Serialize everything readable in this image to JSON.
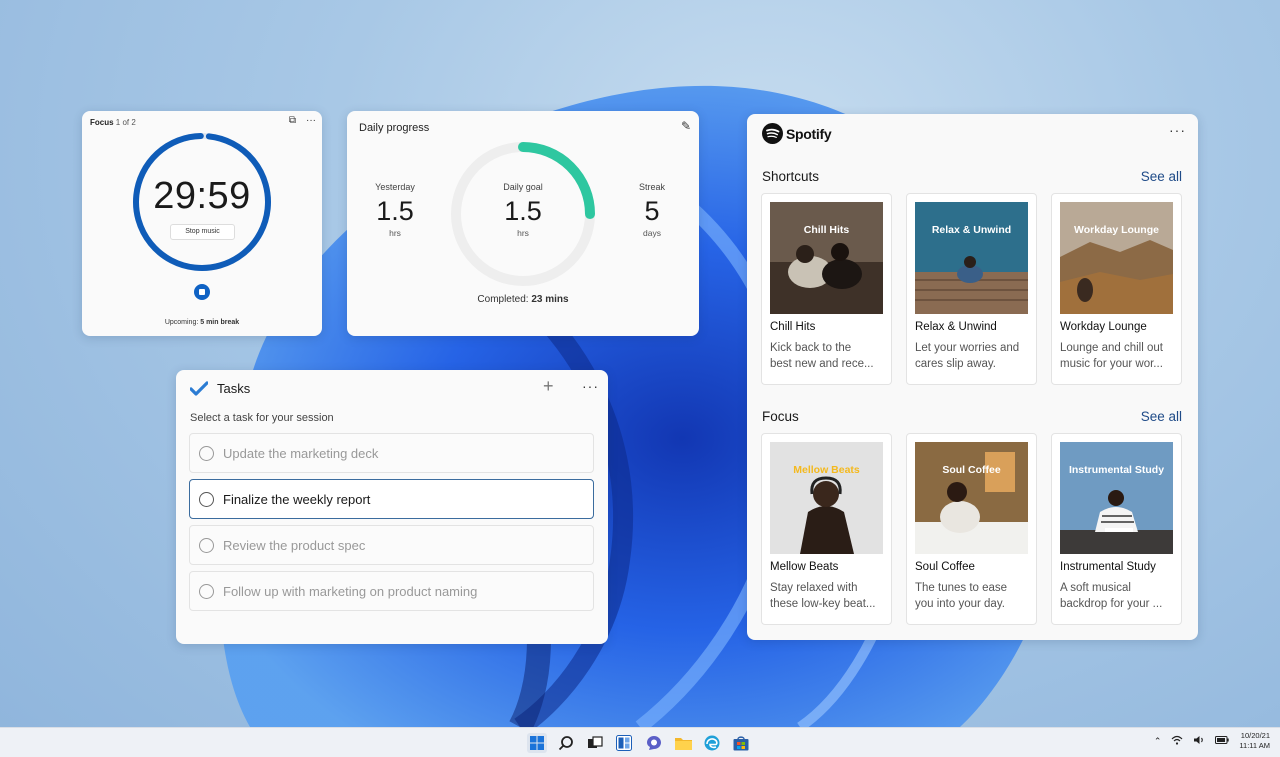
{
  "focus": {
    "title": "Focus",
    "counter": "1 of 2",
    "timer": "29:59",
    "stop_music_label": "Stop music",
    "upcoming_label": "Upcoming:",
    "upcoming_value": "5 min break",
    "ring_progress": 0.98
  },
  "daily_progress": {
    "title": "Daily progress",
    "yesterday": {
      "label": "Yesterday",
      "value": "1.5",
      "unit": "hrs"
    },
    "goal": {
      "label": "Daily goal",
      "value": "1.5",
      "unit": "hrs"
    },
    "streak": {
      "label": "Streak",
      "value": "5",
      "unit": "days"
    },
    "completed_label": "Completed:",
    "completed_value": "23 mins",
    "goal_progress": 0.25,
    "accent_color": "#2ec7a0"
  },
  "tasks": {
    "title": "Tasks",
    "hint": "Select a task for your session",
    "items": [
      {
        "label": "Update the marketing deck",
        "selected": false
      },
      {
        "label": "Finalize the weekly report",
        "selected": true
      },
      {
        "label": "Review the product spec",
        "selected": false
      },
      {
        "label": "Follow up with marketing on product naming",
        "selected": false
      }
    ]
  },
  "spotify": {
    "brand": "Spotify",
    "sections": [
      {
        "title": "Shortcuts",
        "see_all": "See all",
        "tiles": [
          {
            "art_title": "Chill Hits",
            "name": "Chill Hits",
            "desc1": "Kick back to the",
            "desc2": "best new and rece..."
          },
          {
            "art_title": "Relax & Unwind",
            "name": "Relax & Unwind",
            "desc1": "Let your worries and",
            "desc2": "cares slip away."
          },
          {
            "art_title": "Workday Lounge",
            "name": "Workday Lounge",
            "desc1": "Lounge and chill out",
            "desc2": "music for your wor..."
          }
        ]
      },
      {
        "title": "Focus",
        "see_all": "See all",
        "tiles": [
          {
            "art_title": "Mellow Beats",
            "name": "Mellow  Beats",
            "desc1": "Stay relaxed with",
            "desc2": "these low-key beat..."
          },
          {
            "art_title": "Soul Coffee",
            "name": "Soul Coffee",
            "desc1": "The tunes to ease",
            "desc2": "you into your day."
          },
          {
            "art_title": "Instrumental Study",
            "name": "Instrumental Study",
            "desc1": "A soft musical",
            "desc2": "backdrop for your ..."
          }
        ]
      }
    ]
  },
  "taskbar": {
    "date": "10/20/21",
    "time": "11:11 AM",
    "icons": [
      "start-icon",
      "search-icon",
      "task-view-icon",
      "widgets-icon",
      "chat-icon",
      "file-explorer-icon",
      "edge-icon",
      "store-icon"
    ]
  }
}
